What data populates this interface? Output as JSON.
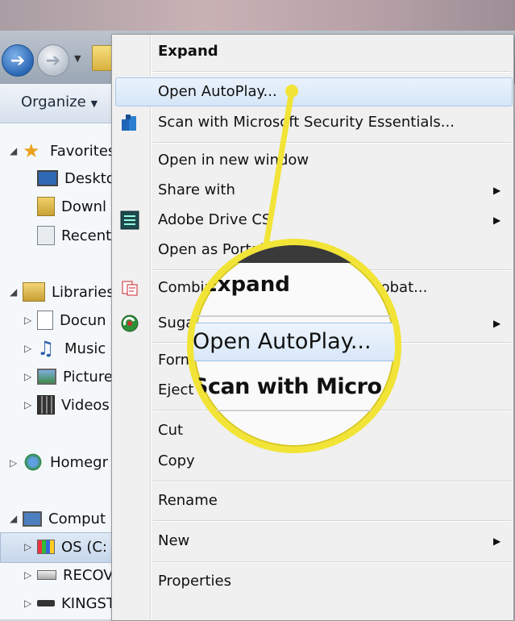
{
  "explorer": {
    "toolbar": {
      "organize_label": "Organize"
    },
    "nav": {
      "favorites": "Favorites",
      "desktop": "Deskto",
      "downloads": "Downl",
      "recent": "Recent",
      "libraries": "Libraries",
      "documents": "Docun",
      "music": "Music",
      "pictures": "Picture",
      "videos": "Videos",
      "homegroup": "Homegr",
      "computer": "Comput",
      "os_drive": "OS (C:",
      "recovery": "RECOV",
      "kingston": "KINGSTON (F:)"
    }
  },
  "context_menu": {
    "items": [
      {
        "label": "Expand",
        "bold": true
      },
      {
        "label": "Open AutoPlay...",
        "highlighted": true
      },
      {
        "label": "Scan with Microsoft Security Essentials...",
        "icon": "security-essentials-icon"
      },
      {
        "label": "Open in new window"
      },
      {
        "label": "Share with",
        "submenu": true
      },
      {
        "label": "Adobe Drive CS",
        "submenu": true,
        "icon": "adobe-drive-icon"
      },
      {
        "label": "Open as Portable Device"
      },
      {
        "label": "Combine supported files in Acrobat...",
        "icon": "acrobat-icon"
      },
      {
        "label": "Sugar",
        "submenu": true,
        "icon": "sugarsync-icon"
      },
      {
        "label": "Format..."
      },
      {
        "label": "Eject"
      },
      {
        "label": "Cut"
      },
      {
        "label": "Copy"
      },
      {
        "label": "Rename"
      },
      {
        "label": "New",
        "submenu": true
      },
      {
        "label": "Properties"
      }
    ]
  },
  "magnifier": {
    "expand": "Expand",
    "open_autoplay": "Open AutoPlay...",
    "scan": "Scan with Micro"
  },
  "colors": {
    "callout": "#f2e436",
    "highlight_border": "#a8c6e8"
  }
}
